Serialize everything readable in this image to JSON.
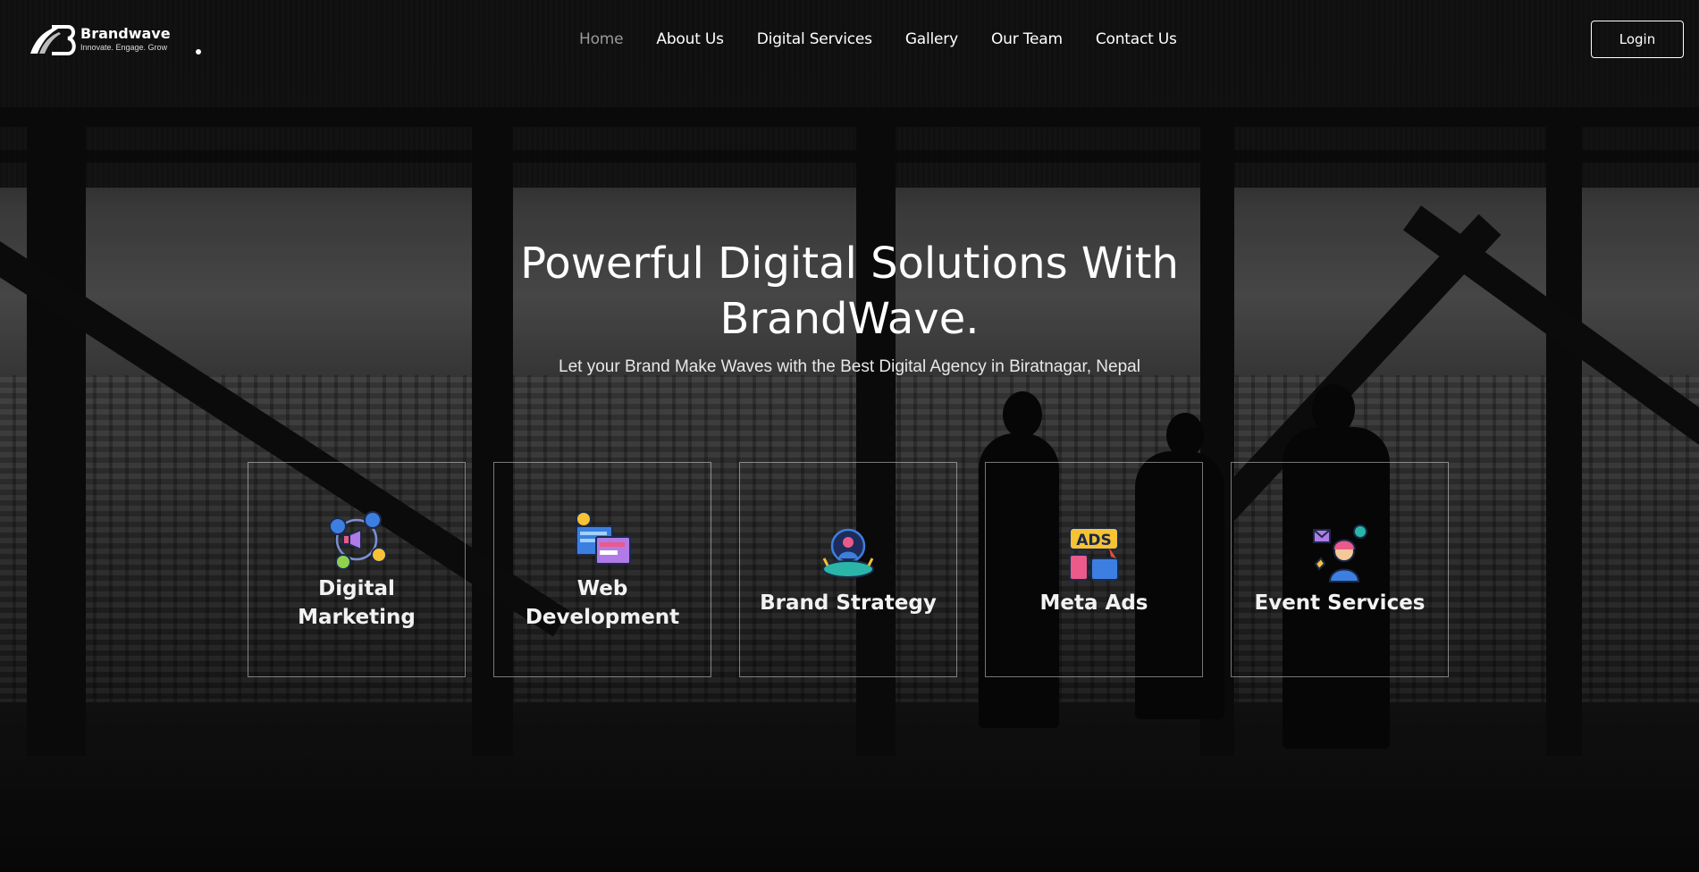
{
  "brand": {
    "name": "Brandwave",
    "tagline": "Innovate. Engage. Grow"
  },
  "nav": {
    "items": [
      {
        "label": "Home",
        "active": true
      },
      {
        "label": "About Us",
        "active": false
      },
      {
        "label": "Digital Services",
        "active": false
      },
      {
        "label": "Gallery",
        "active": false
      },
      {
        "label": "Our Team",
        "active": false
      },
      {
        "label": "Contact Us",
        "active": false
      }
    ],
    "login_label": "Login"
  },
  "hero": {
    "title_line1": "Powerful Digital Solutions With",
    "title_line2": "BrandWave.",
    "subtitle": "Let your Brand Make Waves with the Best Digital Agency in Biratnagar, Nepal"
  },
  "services": [
    {
      "label": "Digital Marketing",
      "icon": "digital-marketing-icon"
    },
    {
      "label": "Web Development",
      "icon": "web-development-icon"
    },
    {
      "label": "Brand Strategy",
      "icon": "brand-strategy-icon"
    },
    {
      "label": "Meta Ads",
      "icon": "meta-ads-icon",
      "icon_text": "ADS"
    },
    {
      "label": "Event Services",
      "icon": "event-services-icon"
    }
  ],
  "colors": {
    "text": "#ffffff",
    "nav_active": "#9a9a9a",
    "card_border": "rgba(255,255,255,0.45)",
    "icon_blue": "#3d7fe0",
    "icon_yellow": "#f7c234",
    "icon_pink": "#ea5a8a"
  }
}
